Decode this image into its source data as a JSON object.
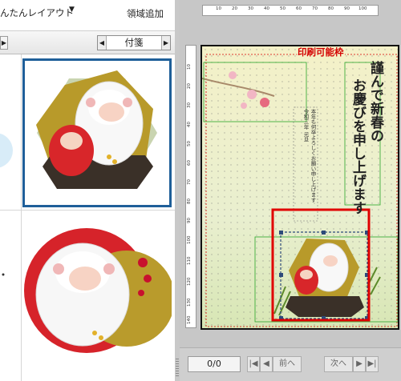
{
  "toolbar": {
    "layout_label": "んたんレイアウト",
    "add_area_label": "領域追加"
  },
  "filter": {
    "category_value": "付箋"
  },
  "paper": {
    "printable_frame_label": "印刷可能枠",
    "greeting_col1": "謹んで新春の",
    "greeting_col2": "お慶びを申し上げます",
    "body_text": "本年も何卒よろしくお願い申し上げます\n令和三年 元旦"
  },
  "ruler": {
    "h_ticks": [
      "10",
      "20",
      "30",
      "40",
      "50",
      "60",
      "70",
      "80",
      "90",
      "100"
    ],
    "v_ticks": [
      "10",
      "20",
      "30",
      "40",
      "50",
      "60",
      "70",
      "80",
      "90",
      "100",
      "110",
      "120",
      "130",
      "140"
    ]
  },
  "nav": {
    "page_indicator": "0/0",
    "prev_label": "前へ",
    "next_label": "次へ"
  },
  "colors": {
    "selection": "#1f5f99",
    "printable_frame": "#d40000",
    "selected_object": "#e00000",
    "text_box_outline": "#2aa52a"
  }
}
